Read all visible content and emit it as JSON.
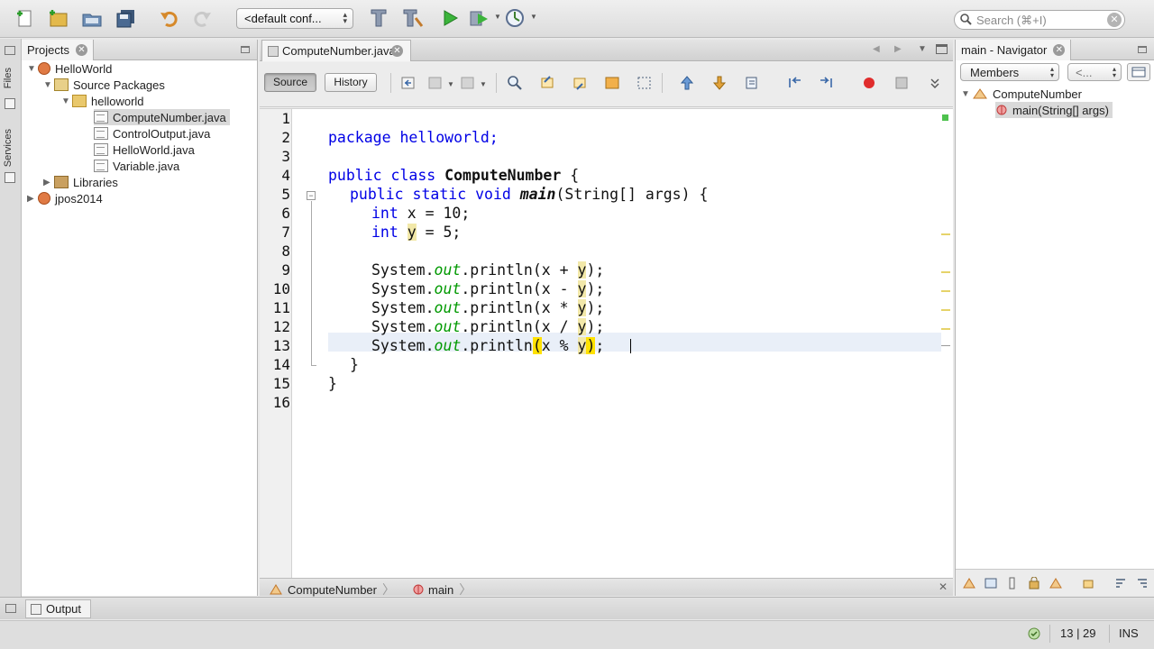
{
  "toolbar": {
    "config_selected": "<default conf...",
    "search_placeholder": "Search (⌘+I)"
  },
  "side_tabs": {
    "files": "Files",
    "services": "Services"
  },
  "projects": {
    "title": "Projects",
    "tree": [
      {
        "label": "HelloWorld",
        "icon": "project-cup-icon",
        "expanded": true
      },
      {
        "label": "Source Packages",
        "icon": "source-packages-icon",
        "expanded": true
      },
      {
        "label": "helloworld",
        "icon": "package-icon",
        "expanded": true
      },
      {
        "label": "ComputeNumber.java",
        "icon": "java-file-icon",
        "selected": true
      },
      {
        "label": "ControlOutput.java",
        "icon": "java-file-icon"
      },
      {
        "label": "HelloWorld.java",
        "icon": "java-file-icon"
      },
      {
        "label": "Variable.java",
        "icon": "java-file-icon"
      },
      {
        "label": "Libraries",
        "icon": "libraries-folder-icon",
        "expanded": false
      },
      {
        "label": "jpos2014",
        "icon": "project-cup-icon",
        "expanded": false
      }
    ]
  },
  "editor": {
    "file_tab": "ComputeNumber.java",
    "source_label": "Source",
    "history_label": "History",
    "line_numbers": [
      "1",
      "2",
      "3",
      "4",
      "5",
      "6",
      "7",
      "8",
      "9",
      "10",
      "11",
      "12",
      "13",
      "14",
      "15",
      "16"
    ],
    "code": {
      "l2": "package helloworld;",
      "l4_kw": "public class ",
      "l4_cls": "ComputeNumber",
      "l4_end": " {",
      "l5_kw": "public static void ",
      "l5_mth": "main",
      "l5_end": "(String[] args) {",
      "int": "int",
      "l6_rest": " x = 10;",
      "l7_var": "y",
      "l7_rest": " = 5;",
      "sys": "System.",
      "out": "out",
      "println": ".println",
      "paren": "(",
      "x_plus": "x + ",
      "x_minus": "x - ",
      "x_times": "x * ",
      "x_div": "x / ",
      "x_mod": "x % ",
      "y": "y",
      "close": ");",
      "close_paren": ")",
      "semi": ";",
      "brace_inner": "}",
      "brace_outer": "}"
    },
    "breadcrumb": [
      "ComputeNumber",
      "main"
    ]
  },
  "navigator": {
    "title": "main - Navigator",
    "filter_selected": "Members",
    "back_selected": "<...",
    "class_node": "ComputeNumber",
    "member_node": "main(String[] args)"
  },
  "output": {
    "tab_label": "Output"
  },
  "status": {
    "position": "13 | 29",
    "mode": "INS"
  },
  "colors": {
    "keyword": "#0000e6",
    "field": "#009900",
    "highlight": "#f2e8a9",
    "brace_match": "#ffe100"
  }
}
